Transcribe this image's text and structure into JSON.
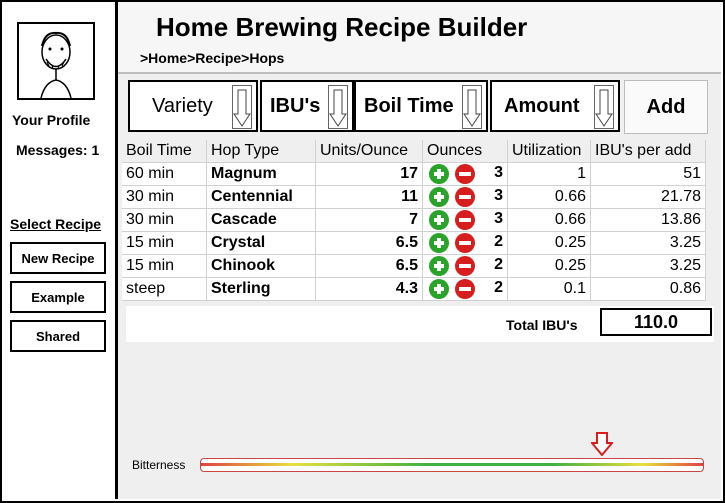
{
  "sidebar": {
    "profile_label": "Your Profile",
    "messages_label": "Messages: 1",
    "select_recipe_label": "Select Recipe",
    "buttons": {
      "new_recipe": "New Recipe",
      "example": "Example",
      "shared": "Shared"
    }
  },
  "header": {
    "title": "Home Brewing Recipe Builder",
    "breadcrumb": ">Home>Recipe>Hops"
  },
  "toolbar": {
    "variety": "Variety",
    "ibus": "IBU's",
    "boil_time": "Boil Time",
    "amount": "Amount",
    "add": "Add"
  },
  "table": {
    "columns": [
      "Boil Time",
      "Hop Type",
      "Units/Ounce",
      "Ounces",
      "Utilization",
      "IBU's per add"
    ],
    "rows": [
      {
        "boil": "60 min",
        "hop": "Magnum",
        "units": "17",
        "ounces": "3",
        "util": "1",
        "ibu": "51"
      },
      {
        "boil": "30 min",
        "hop": "Centennial",
        "units": "11",
        "ounces": "3",
        "util": "0.66",
        "ibu": "21.78"
      },
      {
        "boil": "30 min",
        "hop": "Cascade",
        "units": "7",
        "ounces": "3",
        "util": "0.66",
        "ibu": "13.86"
      },
      {
        "boil": "15 min",
        "hop": "Crystal",
        "units": "6.5",
        "ounces": "2",
        "util": "0.25",
        "ibu": "3.25"
      },
      {
        "boil": "15 min",
        "hop": "Chinook",
        "units": "6.5",
        "ounces": "2",
        "util": "0.25",
        "ibu": "3.25"
      },
      {
        "boil": "steep",
        "hop": "Sterling",
        "units": "4.3",
        "ounces": "2",
        "util": "0.1",
        "ibu": "0.86"
      }
    ]
  },
  "total": {
    "label": "Total IBU's",
    "value": "110.0"
  },
  "bitterness": {
    "label": "Bitterness",
    "level": 0.8,
    "marker_color": "#d71e1e"
  },
  "colors": {
    "plus": "#2aa32a",
    "minus": "#d71e1e"
  }
}
